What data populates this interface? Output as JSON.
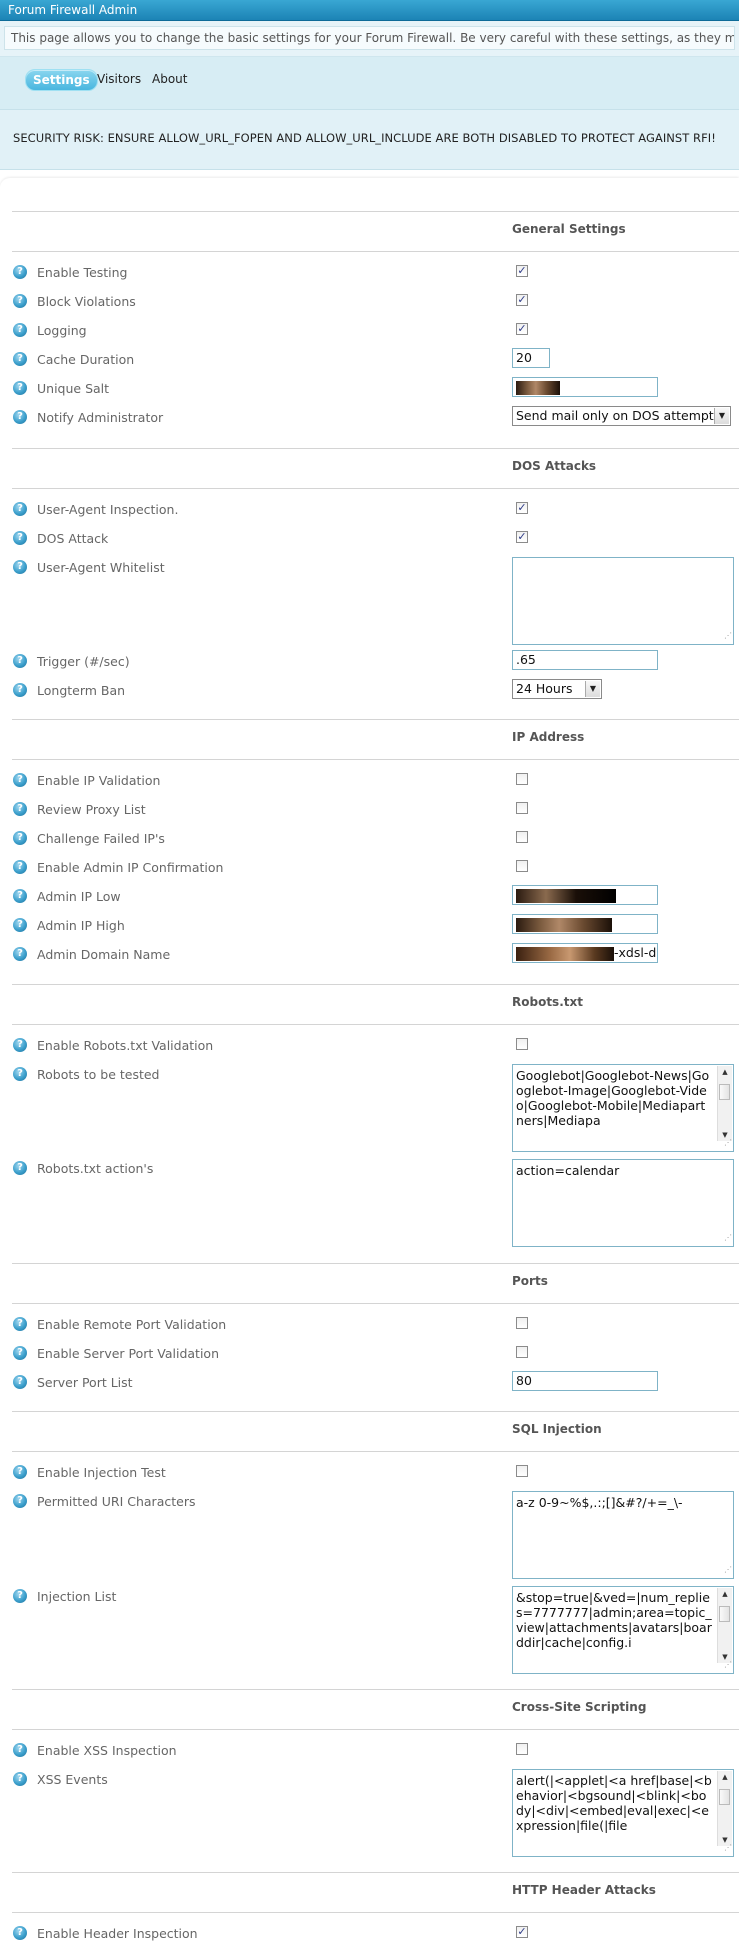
{
  "window": {
    "title": "Forum Firewall Admin"
  },
  "notice": "This page allows you to change the basic settings for your Forum Firewall. Be very careful with these settings, as they may ren",
  "tabs": [
    {
      "label": "Settings",
      "active": true
    },
    {
      "label": "Visitors",
      "active": false
    },
    {
      "label": "About",
      "active": false
    }
  ],
  "security_warning": "SECURITY RISK: ENSURE ALLOW_URL_FOPEN AND ALLOW_URL_INCLUDE ARE BOTH DISABLED TO PROTECT AGAINST RFI!",
  "help_icon_glyph": "?",
  "colors": {
    "titlebar": "#1c83b5",
    "tab_active": "#49b6df",
    "checkmark": "#2e3b87"
  },
  "general": {
    "title": "General Settings",
    "enable_testing": {
      "label": "Enable Testing",
      "checked": true
    },
    "block_violations": {
      "label": "Block Violations",
      "checked": true
    },
    "logging": {
      "label": "Logging",
      "checked": true
    },
    "cache_duration": {
      "label": "Cache Duration",
      "value": "20"
    },
    "unique_salt": {
      "label": "Unique Salt"
    },
    "notify_admin": {
      "label": "Notify Administrator",
      "selected": "Send mail only on DOS attempt"
    }
  },
  "dos": {
    "title": "DOS Attacks",
    "ua_inspection": {
      "label": "User-Agent Inspection.",
      "checked": true
    },
    "dos_attack": {
      "label": "DOS Attack",
      "checked": true
    },
    "ua_whitelist": {
      "label": "User-Agent Whitelist",
      "value": ""
    },
    "trigger": {
      "label": "Trigger (#/sec)",
      "value": ".65"
    },
    "longterm_ban": {
      "label": "Longterm Ban",
      "selected": "24 Hours"
    }
  },
  "ip": {
    "title": "IP Address",
    "enable_ip_validation": {
      "label": "Enable IP Validation",
      "checked": false
    },
    "review_proxy": {
      "label": "Review Proxy List",
      "checked": false
    },
    "challenge_failed": {
      "label": "Challenge Failed IP's",
      "checked": false
    },
    "admin_ip_confirm": {
      "label": "Enable Admin IP Confirmation",
      "checked": false
    },
    "admin_ip_low": {
      "label": "Admin IP Low"
    },
    "admin_ip_high": {
      "label": "Admin IP High"
    },
    "admin_domain": {
      "label": "Admin Domain Name",
      "visible_suffix": "-xdsl-d"
    }
  },
  "robots": {
    "title": "Robots.txt",
    "enable_validation": {
      "label": "Enable Robots.txt Validation",
      "checked": false
    },
    "robots_tested": {
      "label": "Robots to be tested",
      "value": "Googlebot|Googlebot-News|Googlebot-Image|Googlebot-Video|Googlebot-Mobile|Mediapartners|Mediapa"
    },
    "robots_actions": {
      "label": "Robots.txt action's",
      "value": "action=calendar"
    }
  },
  "ports": {
    "title": "Ports",
    "remote_port": {
      "label": "Enable Remote Port Validation",
      "checked": false
    },
    "server_port": {
      "label": "Enable Server Port Validation",
      "checked": false
    },
    "server_port_list": {
      "label": "Server Port List",
      "value": "80"
    }
  },
  "sql": {
    "title": "SQL Injection",
    "enable_test": {
      "label": "Enable Injection Test",
      "checked": false
    },
    "permitted_chars": {
      "label": "Permitted URI Characters",
      "value": "a-z 0-9~%$,.:;[]&#?/+=_\\-"
    },
    "injection_list": {
      "label": "Injection List",
      "value": "&stop=true|&ved=|num_replies=7777777|admin;area=topic_view|attachments|avatars|boarddir|cache|config.i"
    }
  },
  "xss": {
    "title": "Cross-Site Scripting",
    "enable_inspection": {
      "label": "Enable XSS Inspection",
      "checked": false
    },
    "events": {
      "label": "XSS Events",
      "value": "alert(|<applet|<a href|base|<behavior|<bgsound|<blink|<body|<div|<embed|eval|exec|<expression|file(|file"
    }
  },
  "http": {
    "title": "HTTP Header Attacks",
    "enable_header_inspection": {
      "label": "Enable Header Inspection",
      "checked": true
    }
  }
}
